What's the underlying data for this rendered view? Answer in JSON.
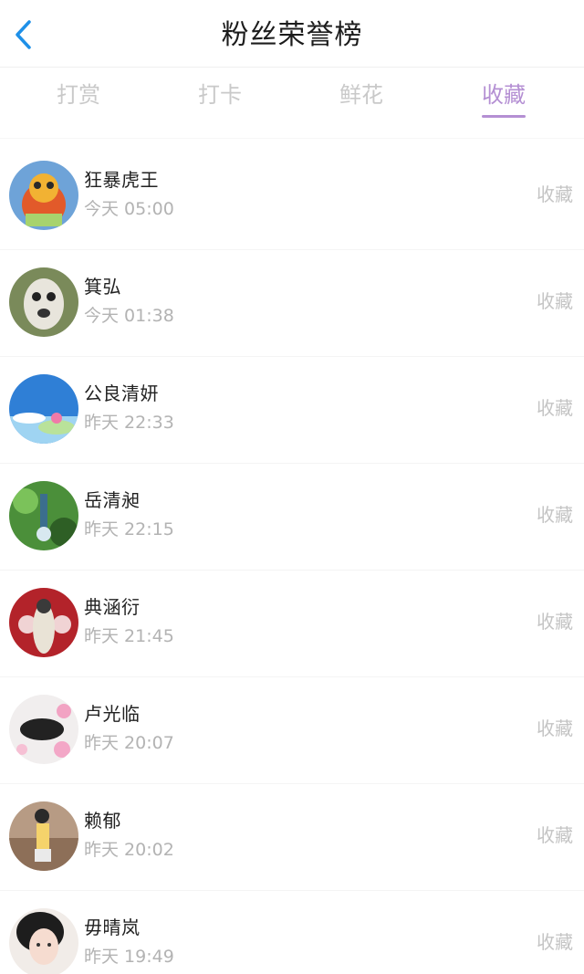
{
  "header": {
    "title": "粉丝荣誉榜",
    "back_icon": "chevron-left-icon"
  },
  "colors": {
    "accent": "#b48fd3",
    "back": "#1e90e8",
    "muted": "#c4c4c4"
  },
  "tabs": [
    {
      "label": "打赏",
      "active": false
    },
    {
      "label": "打卡",
      "active": false
    },
    {
      "label": "鲜花",
      "active": false
    },
    {
      "label": "收藏",
      "active": true
    }
  ],
  "fans": [
    {
      "name": "狂暴虎王",
      "time": "今天 05:00",
      "action": "收藏"
    },
    {
      "name": "箕弘",
      "time": "今天 01:38",
      "action": "收藏"
    },
    {
      "name": "公良清妍",
      "time": "昨天 22:33",
      "action": "收藏"
    },
    {
      "name": "岳清昶",
      "time": "昨天 22:15",
      "action": "收藏"
    },
    {
      "name": "典涵衍",
      "time": "昨天 21:45",
      "action": "收藏"
    },
    {
      "name": "卢光临",
      "time": "昨天 20:07",
      "action": "收藏"
    },
    {
      "name": "赖郁",
      "time": "昨天 20:02",
      "action": "收藏"
    },
    {
      "name": "毋晴岚",
      "time": "昨天 19:49",
      "action": "收藏"
    }
  ]
}
